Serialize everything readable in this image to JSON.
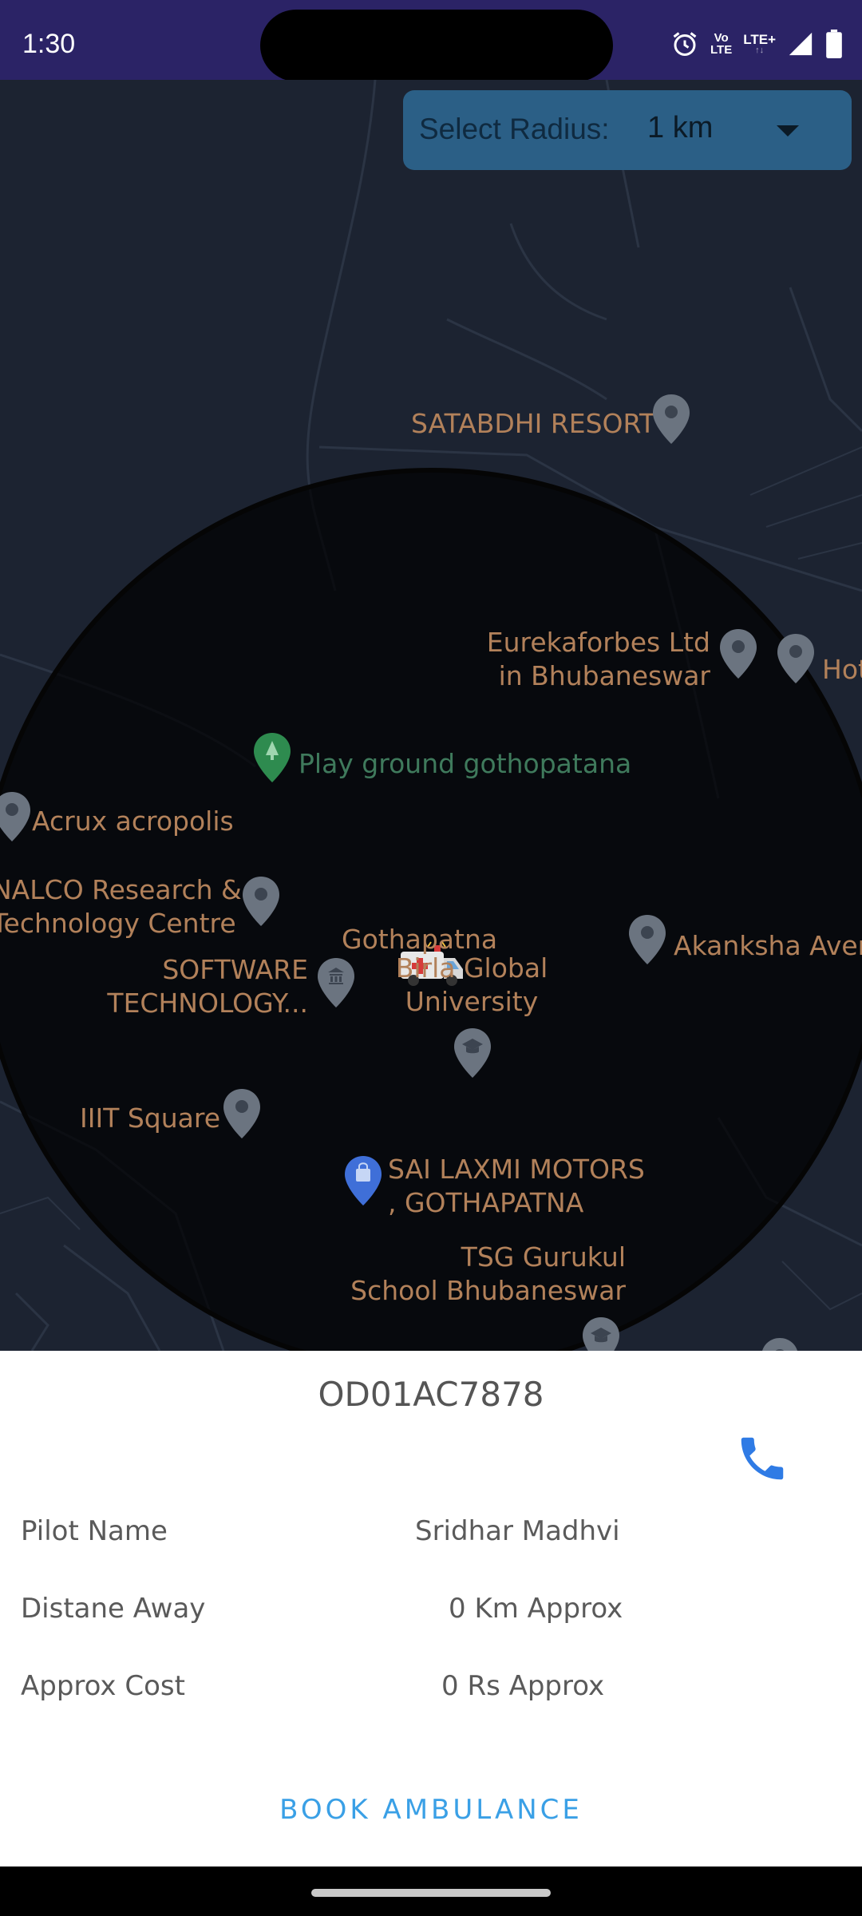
{
  "status_bar": {
    "time": "1:30",
    "net_top": "Vo",
    "net_mid": "LTE",
    "lte_label": "LTE+",
    "icons": [
      "alarm-icon",
      "volte-icon",
      "lte-plus-icon",
      "signal-icon",
      "battery-icon"
    ]
  },
  "radius_selector": {
    "label": "Select Radius:",
    "value": "1 km"
  },
  "map": {
    "places": {
      "satabdhi": "SATABDHI RESORT",
      "eureka_1": "Eurekaforbes Ltd",
      "eureka_2": "in Bhubaneswar",
      "hotel": "Hot",
      "playground": "Play ground gothopatana",
      "acrux": "Acrux acropolis",
      "nalco_1": "NALCO Research &",
      "nalco_2": "Technology Centre",
      "gothapatna": "Gothapatna",
      "akanksha": "Akanksha Aven",
      "software_1": "SOFTWARE",
      "software_2": "TECHNOLOGY...",
      "birla_1": "Birla Global",
      "birla_2": "University",
      "iiit": "IIIT Square",
      "sai_1": "SAI LAXMI MOTORS",
      "sai_2": ", GOTHAPATNA",
      "tsg_1": "TSG Gurukul",
      "tsg_2": "School Bhubaneswar"
    }
  },
  "ambulance_details": {
    "vehicle_number": "OD01AC7878",
    "rows": [
      {
        "label": "Pilot Name",
        "value": "Sridhar Madhvi"
      },
      {
        "label": "Distane Away",
        "value": "0 Km Approx"
      },
      {
        "label": "Approx Cost",
        "value": "0 Rs Approx"
      }
    ],
    "book_button": "BOOK AMBULANCE"
  },
  "colors": {
    "status_bar": "#2b2366",
    "map_background": "#1c2331",
    "dropdown": "#2b5f86",
    "place_label": "#b2815a",
    "park_label": "#3f7a5c",
    "accent_blue": "#3aa0e6",
    "phone_icon": "#2f7be5"
  }
}
